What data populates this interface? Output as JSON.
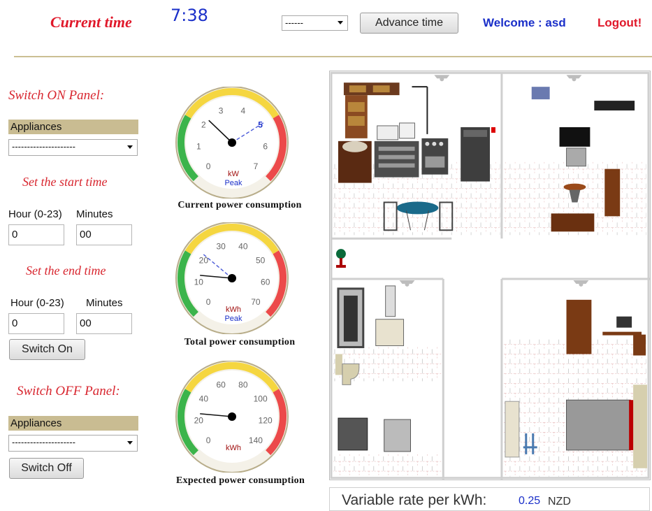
{
  "header": {
    "current_time_label": "Current time",
    "clock_value": "7:38",
    "advance_select_value": "------",
    "advance_button": "Advance time",
    "welcome_text": "Welcome : asd",
    "logout_link": "Logout!"
  },
  "switch_on_panel": {
    "title": "Switch ON Panel:",
    "appliances_label": "Appliances",
    "appliance_select_value": "---------------------",
    "start_title": "Set the start time",
    "start_hour_label": "Hour (0-23)",
    "start_minutes_label": "Minutes",
    "start_hour_value": "0",
    "start_minutes_value": "00",
    "end_title": "Set the end time",
    "end_hour_label": "Hour (0-23)",
    "end_minutes_label": "Minutes",
    "end_hour_value": "0",
    "end_minutes_value": "00",
    "switch_on_button": "Switch On"
  },
  "switch_off_panel": {
    "title": "Switch OFF Panel:",
    "appliances_label": "Appliances",
    "appliance_select_value": "---------------------",
    "switch_off_button": "Switch Off"
  },
  "gauges": [
    {
      "caption": "Current power consumption",
      "unit": "kW",
      "sub_label": "Peak",
      "ticks": [
        "0",
        "1",
        "2",
        "3",
        "4",
        "5",
        "6",
        "7"
      ],
      "min": 0,
      "max": 7,
      "value": 2.3,
      "peak": 5,
      "highlight_tick": "5"
    },
    {
      "caption": "Total power consumption",
      "unit": "kWh",
      "sub_label": "Peak",
      "ticks": [
        "0",
        "10",
        "20",
        "30",
        "40",
        "50",
        "60",
        "70"
      ],
      "min": 0,
      "max": 70,
      "value": 13,
      "peak": 22,
      "highlight_tick": ""
    },
    {
      "caption": "Expected power consumption",
      "unit": "kWh",
      "sub_label": "",
      "ticks": [
        "0",
        "20",
        "40",
        "60",
        "80",
        "100",
        "120",
        "140"
      ],
      "min": 0,
      "max": 140,
      "value": 26,
      "highlight_tick": ""
    }
  ],
  "rate": {
    "label": "Variable rate per kWh:",
    "value": "0.25",
    "unit": "NZD"
  },
  "colors": {
    "accent_red": "#e0182a",
    "accent_blue": "#1a2fc9",
    "panel_tan": "#c9bc92",
    "gauge_green": "#3cb44b",
    "gauge_yellow": "#f5d640",
    "gauge_red": "#ec4a4a"
  }
}
